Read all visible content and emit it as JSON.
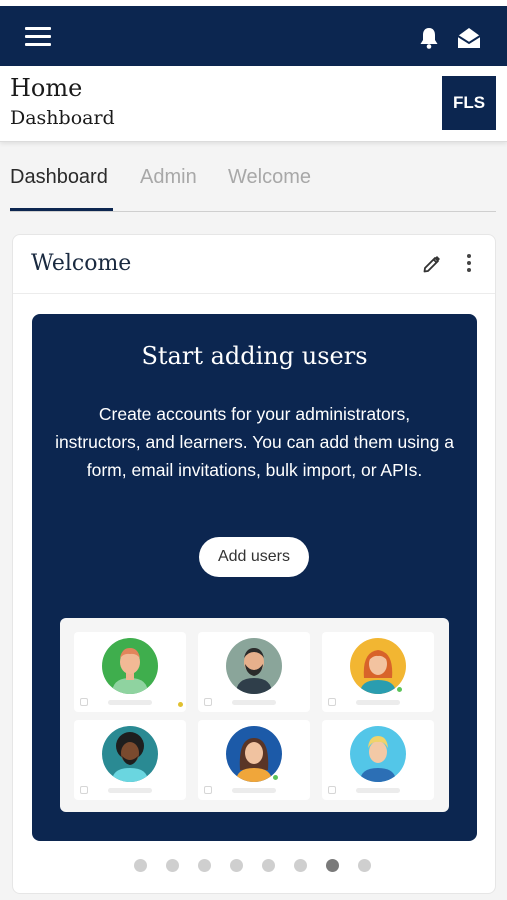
{
  "header": {
    "title": "Home",
    "subtitle": "Dashboard",
    "logo_text": "FLS"
  },
  "topbar": {
    "icons": [
      "hamburger-menu-icon",
      "bell-icon",
      "mail-icon"
    ],
    "color": "#0c2650"
  },
  "tabs": [
    {
      "label": "Dashboard",
      "active": true
    },
    {
      "label": "Admin",
      "active": false
    },
    {
      "label": "Welcome",
      "active": false
    }
  ],
  "card": {
    "title": "Welcome",
    "icons": [
      "edit-pencil-icon",
      "more-vertical-icon"
    ]
  },
  "promo": {
    "title": "Start adding users",
    "body": "Create accounts for your administrators, instructors, and learners. You can add them using a form, email invitations, bulk import, or APIs.",
    "button_label": "Add users",
    "background": "#0c2650"
  },
  "carousel": {
    "total": 8,
    "active_index": 6
  }
}
